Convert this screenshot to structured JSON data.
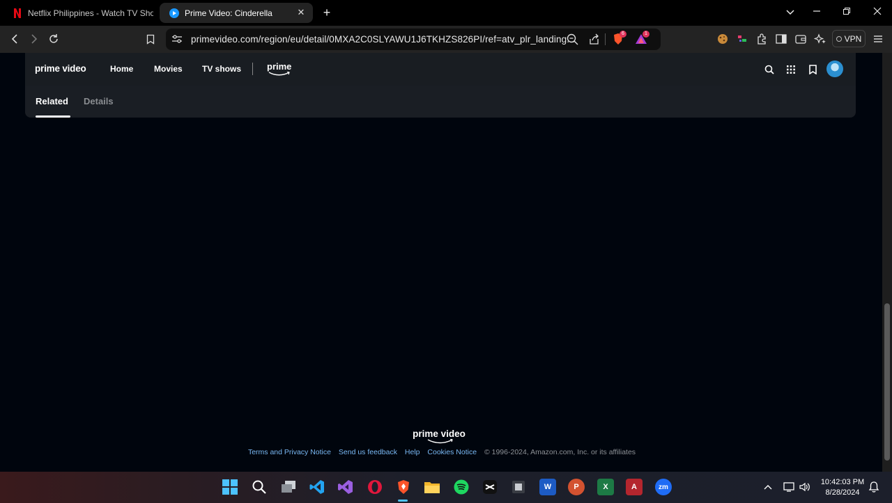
{
  "browser": {
    "tabs": [
      {
        "title": "Netflix Philippines - Watch TV Show",
        "favicon": "netflix-icon",
        "active": false
      },
      {
        "title": "Prime Video: Cinderella",
        "favicon": "prime-video-icon",
        "active": true
      }
    ],
    "new_tab": "+",
    "url": "primevideo.com/region/eu/detail/0MXA2C0SLYAWU1J6TKHZS826PI/ref=atv_plr_landing...",
    "vpn_label": "VPN",
    "brave_badge": "6",
    "rewards_badge": "1"
  },
  "header": {
    "logo": "prime video",
    "nav": [
      "Home",
      "Movies",
      "TV shows"
    ],
    "prime_logo": "prime"
  },
  "tabs": {
    "related": "Related",
    "details": "Details"
  },
  "footer": {
    "logo": "prime video",
    "links": [
      "Terms and Privacy Notice",
      "Send us feedback",
      "Help",
      "Cookies Notice"
    ],
    "copyright": "© 1996-2024, Amazon.com, Inc. or its affiliates"
  },
  "taskbar": {
    "time": "10:42:03 PM",
    "date": "8/28/2024"
  },
  "colors": {
    "page_bg": "#00050d",
    "header_bg": "#1a1e24",
    "link": "#79b8f3",
    "accent": "#4fc3f7"
  }
}
